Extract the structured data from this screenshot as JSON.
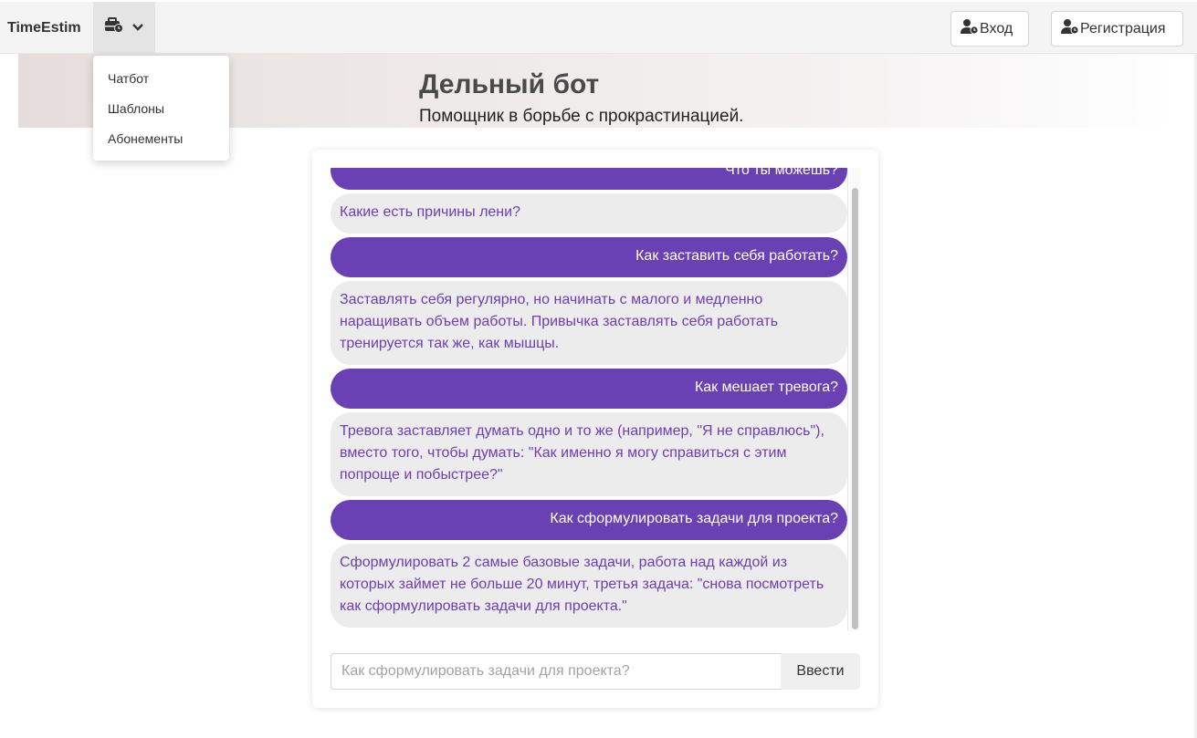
{
  "navbar": {
    "brand": "TimeEstim",
    "tools_icon": "toolbox-clock-icon",
    "chevron_icon": "chevron-down-icon",
    "login_label": "Вход",
    "register_label": "Регистрация",
    "user_icon": "user-clock-icon"
  },
  "dropdown": {
    "items": [
      {
        "label": "Чатбот"
      },
      {
        "label": "Шаблоны"
      },
      {
        "label": "Абонементы"
      }
    ]
  },
  "hero": {
    "title": "Дельный бот",
    "subtitle": "Помощник в борьбе с прокрастинацией."
  },
  "chat": {
    "messages": [
      {
        "role": "user",
        "text": "Что ты можешь?"
      },
      {
        "role": "bot",
        "text": "Какие есть причины лени?"
      },
      {
        "role": "user",
        "text": "Как заставить себя работать?"
      },
      {
        "role": "bot",
        "text": "Заставлять себя регулярно, но начинать с малого и медленно наращивать объем работы. Привычка заставлять себя работать тренируется так же, как мышцы."
      },
      {
        "role": "user",
        "text": "Как мешает тревога?"
      },
      {
        "role": "bot",
        "text": "Тревога заставляет думать одно и то же (например, \"Я не справлюсь\"), вместо того, чтобы думать: \"Как именно я могу справиться с этим попроще и побыстрее?\""
      },
      {
        "role": "user",
        "text": "Как сформулировать задачи для проекта?"
      },
      {
        "role": "bot",
        "text": "Сформулировать 2 самые базовые задачи, работа над каждой из которых займет не больше 20 минут, третья задача: \"снова посмотреть как сформулировать задачи для проекта.\""
      }
    ],
    "input_placeholder": "Как сформулировать задачи для проекта?",
    "send_label": "Ввести"
  },
  "colors": {
    "user_bubble": "#6a40b5",
    "bot_bubble": "#ececec",
    "bot_text": "#6a40b5"
  }
}
